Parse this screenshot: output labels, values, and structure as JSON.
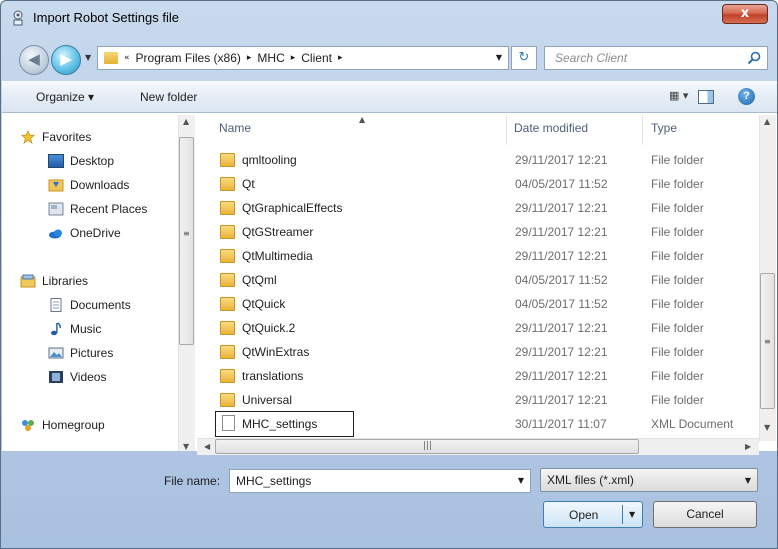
{
  "window": {
    "title": "Import Robot Settings file",
    "close": "x"
  },
  "nav": {
    "back": "◀",
    "forward": "▶",
    "history": "▼",
    "address": {
      "overflow": "«",
      "crumbs": [
        "Program Files (x86)",
        "MHC",
        "Client"
      ],
      "sep": "▸",
      "dropdown": "▼"
    },
    "refresh": "↻",
    "search": {
      "placeholder": "Search Client"
    }
  },
  "toolbar": {
    "organize": "Organize ▾",
    "new_folder": "New folder",
    "view": "▦ ▾",
    "help": "?"
  },
  "sidebar": {
    "favorites": {
      "label": "Favorites",
      "items": [
        "Desktop",
        "Downloads",
        "Recent Places",
        "OneDrive"
      ]
    },
    "libraries": {
      "label": "Libraries",
      "items": [
        "Documents",
        "Music",
        "Pictures",
        "Videos"
      ]
    },
    "homegroup": "Homegroup"
  },
  "columns": {
    "name": "Name",
    "date": "Date modified",
    "type": "Type"
  },
  "files": [
    {
      "name": "qmltooling",
      "date": "29/11/2017 12:21",
      "type": "File folder"
    },
    {
      "name": "Qt",
      "date": "04/05/2017 11:52",
      "type": "File folder"
    },
    {
      "name": "QtGraphicalEffects",
      "date": "29/11/2017 12:21",
      "type": "File folder"
    },
    {
      "name": "QtGStreamer",
      "date": "29/11/2017 12:21",
      "type": "File folder"
    },
    {
      "name": "QtMultimedia",
      "date": "29/11/2017 12:21",
      "type": "File folder"
    },
    {
      "name": "QtQml",
      "date": "04/05/2017 11:52",
      "type": "File folder"
    },
    {
      "name": "QtQuick",
      "date": "04/05/2017 11:52",
      "type": "File folder"
    },
    {
      "name": "QtQuick.2",
      "date": "29/11/2017 12:21",
      "type": "File folder"
    },
    {
      "name": "QtWinExtras",
      "date": "29/11/2017 12:21",
      "type": "File folder"
    },
    {
      "name": "translations",
      "date": "29/11/2017 12:21",
      "type": "File folder"
    },
    {
      "name": "Universal",
      "date": "29/11/2017 12:21",
      "type": "File folder"
    },
    {
      "name": "MHC_settings",
      "date": "30/11/2017 11:07",
      "type": "XML Document"
    }
  ],
  "bottom": {
    "file_name_label": "File name:",
    "file_name_value": "MHC_settings",
    "filter": "XML files (*.xml)",
    "open": "Open",
    "cancel": "Cancel"
  },
  "colors": {
    "accent": "#2b7fc0",
    "title_bar": "#b9cde6",
    "close": "#c0412a"
  }
}
